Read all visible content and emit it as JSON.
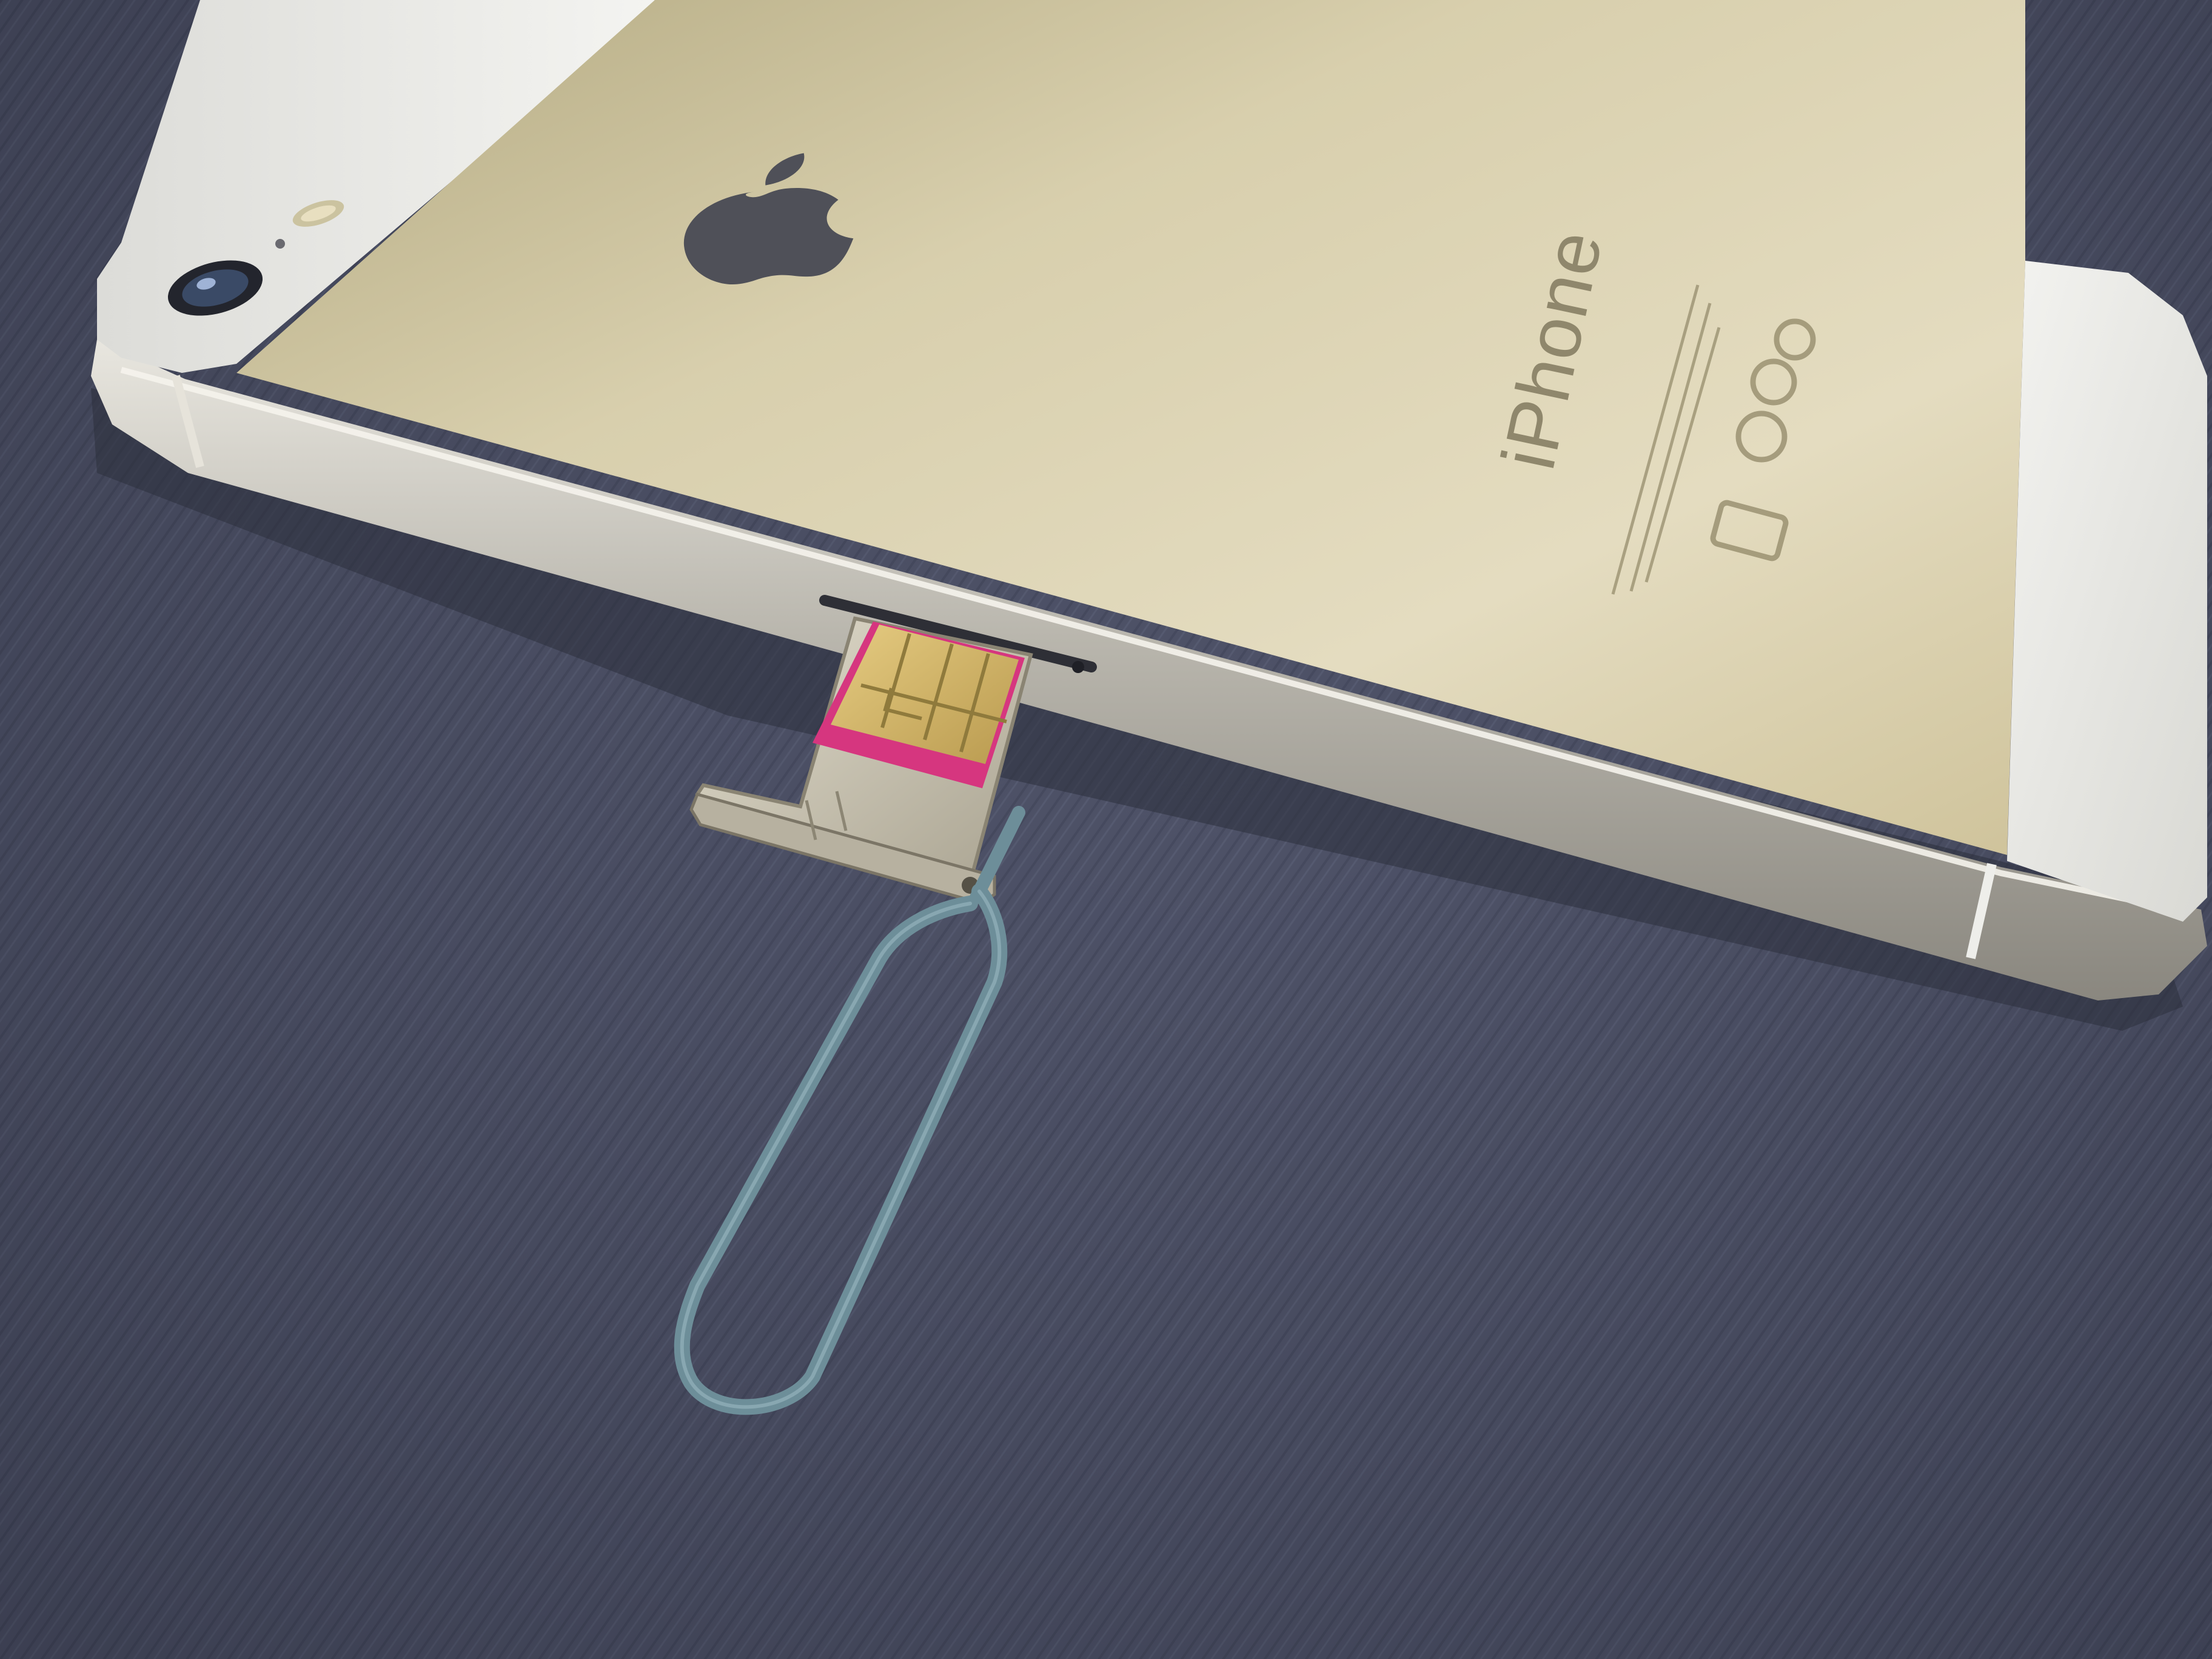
{
  "photo": {
    "engraving": {
      "model_name": "iPhone"
    },
    "colors": {
      "fabric": "#4a4e63",
      "fabric_dark": "#3e4256",
      "gold_back_light": "#dcd3b4",
      "gold_back_dark": "#b8ad8a",
      "white_glass": "#ecebe6",
      "aluminum_edge": "#c9c7bf",
      "apple_logo": "#4f5058",
      "sim_pink": "#d6367f",
      "sim_gold": "#d1b66a",
      "tray_metal": "#c8c3b3",
      "ejector_tool": "#6d8e99"
    }
  }
}
